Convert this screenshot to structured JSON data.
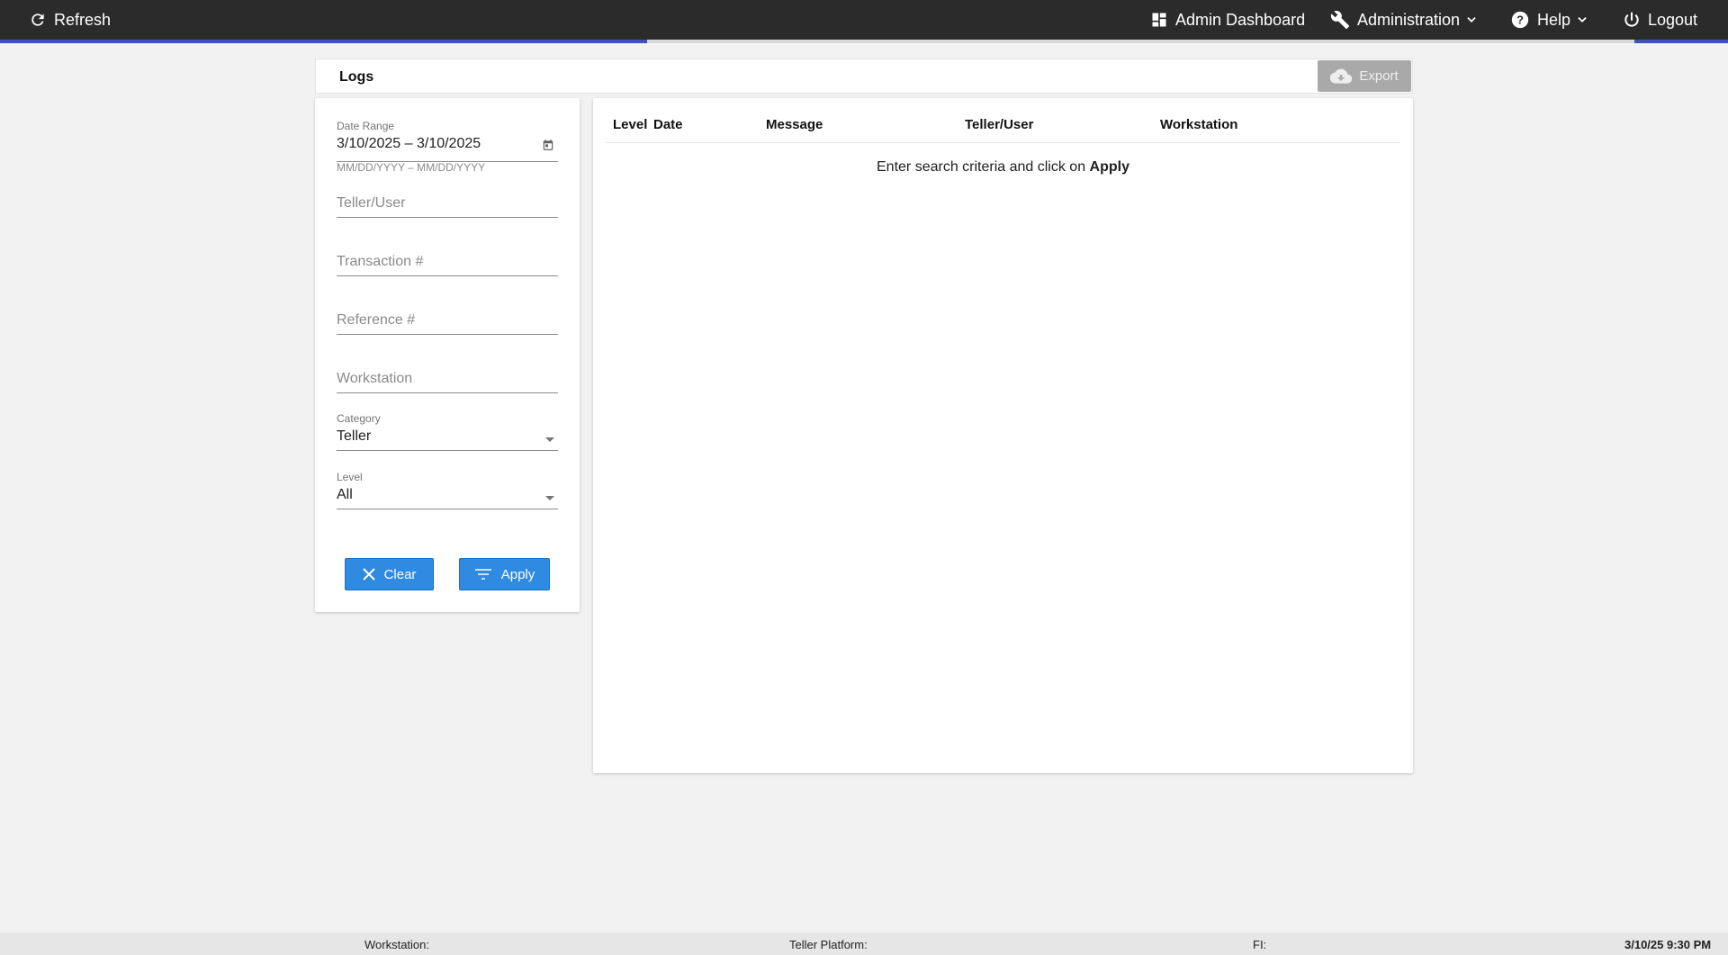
{
  "topbar": {
    "refresh_label": "Refresh",
    "admin_dashboard_label": "Admin Dashboard",
    "administration_label": "Administration",
    "help_label": "Help",
    "logout_label": "Logout"
  },
  "header": {
    "title": "Logs",
    "export_label": "Export"
  },
  "filters": {
    "date_range": {
      "label": "Date Range",
      "value": "3/10/2025 – 3/10/2025",
      "hint": "MM/DD/YYYY – MM/DD/YYYY"
    },
    "teller_user_placeholder": "Teller/User",
    "transaction_placeholder": "Transaction #",
    "reference_placeholder": "Reference #",
    "workstation_placeholder": "Workstation",
    "category": {
      "label": "Category",
      "value": "Teller"
    },
    "level": {
      "label": "Level",
      "value": "All"
    },
    "clear_label": "Clear",
    "apply_label": "Apply"
  },
  "results": {
    "columns": [
      "Level",
      "Date",
      "Message",
      "Teller/User",
      "Workstation"
    ],
    "empty_prefix": "Enter search criteria and click on ",
    "empty_emphasis": "Apply"
  },
  "footer": {
    "workstation_label": "Workstation:",
    "teller_platform_label": "Teller Platform:",
    "fi_label": "FI:",
    "datetime": "3/10/25 9:30 PM"
  },
  "colors": {
    "topbar": "#2b2b2b",
    "accent": "#3f51b5",
    "primary_button": "#2f8be1",
    "export_disabled": "#a9a9a9"
  }
}
